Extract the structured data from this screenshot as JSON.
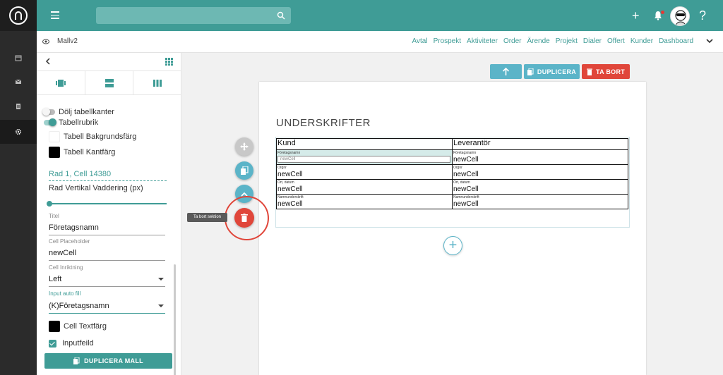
{
  "nav": {
    "title": "Mallv2",
    "links": [
      "Avtal",
      "Prospekt",
      "Aktiviteter",
      "Order",
      "Ärende",
      "Projekt",
      "Dialer",
      "Offert",
      "Kunder",
      "Dashboard"
    ]
  },
  "topbar": {
    "add_label": "+",
    "help_label": "?"
  },
  "panel": {
    "hide_borders_label": "Dölj tabellkanter",
    "table_header_label": "Tabellrubrik",
    "table_bg_label": "Tabell Bakgrundsfärg",
    "table_border_label": "Tabell Kantfärg",
    "selected_cell": "Rad 1, Cell 14380",
    "row_padding_label": "Rad Vertikal Vaddering (px)",
    "title_label": "Titel",
    "title_value": "Företagsnamn",
    "placeholder_label": "Cell Placeholder",
    "placeholder_value": "newCell",
    "align_label": "Cell Inriktning",
    "align_value": "Left",
    "autofill_label": "Input auto fill",
    "autofill_value": "(K)Företagsnamn",
    "text_color_label": "Cell Textfärg",
    "inputfield_label": "Inputfeild",
    "duplicate_template_label": "DUPLICERA MALL"
  },
  "toolbar": {
    "duplicate_label": "DUPLICERA",
    "delete_label": "TA BORT"
  },
  "document": {
    "section_title": "UNDERSKRIFTER",
    "headers": [
      "Kund",
      "Leverantör"
    ],
    "rows": [
      {
        "left_label": "Företagsnamn",
        "left_value": "newCell",
        "right_label": "Företagsnamn",
        "right_value": "newCell"
      },
      {
        "left_label": "Orgnr",
        "left_value": "newCell",
        "right_label": "Orgnr",
        "right_value": "newCell"
      },
      {
        "left_label": "Ort, datum",
        "left_value": "newCell",
        "right_label": "Ort, datum",
        "right_value": "newCell"
      },
      {
        "left_label": "Namnunderskrift",
        "left_value": "newCell",
        "right_label": "Namnunderskrift",
        "right_value": "newCell"
      }
    ],
    "add_label": "+"
  },
  "tooltip": "Ta bort sektion",
  "colors": {
    "brand": "#3f9c96",
    "accent": "#5bb4c8",
    "danger": "#e0463a"
  }
}
